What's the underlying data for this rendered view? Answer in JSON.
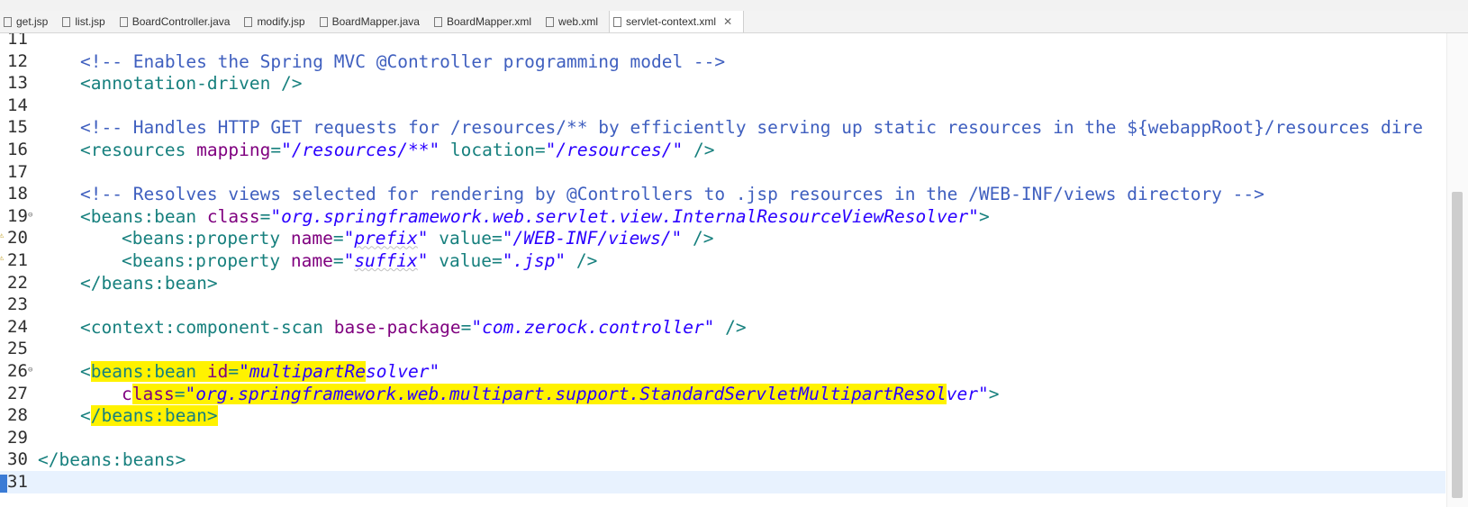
{
  "tabs": [
    {
      "label": "get.jsp",
      "icon": "jsp-file-icon"
    },
    {
      "label": "list.jsp",
      "icon": "jsp-file-icon"
    },
    {
      "label": "BoardController.java",
      "icon": "java-file-icon"
    },
    {
      "label": "modify.jsp",
      "icon": "jsp-file-icon"
    },
    {
      "label": "BoardMapper.java",
      "icon": "java-file-icon"
    },
    {
      "label": "BoardMapper.xml",
      "icon": "xml-file-icon"
    },
    {
      "label": "web.xml",
      "icon": "xml-file-icon"
    },
    {
      "label": "servlet-context.xml",
      "icon": "xml-file-icon",
      "active": true,
      "close": "✕"
    }
  ],
  "editor": {
    "lines": [
      {
        "n": "11",
        "t": []
      },
      {
        "n": "12",
        "t": [
          [
            "cm",
            "<!-- Enables the Spring MVC @Controller programming model -->"
          ]
        ]
      },
      {
        "n": "13",
        "t": [
          [
            "tg",
            "<annotation-driven />"
          ]
        ]
      },
      {
        "n": "14",
        "t": []
      },
      {
        "n": "15",
        "t": [
          [
            "cm",
            "<!-- Handles HTTP GET requests for /resources/** by efficiently serving up static resources in the ${webappRoot}/resources dire"
          ]
        ]
      },
      {
        "n": "16",
        "t": [
          [
            "tg",
            "<resources "
          ],
          [
            "at",
            "mapping"
          ],
          [
            "tg",
            "="
          ],
          [
            "st",
            "\"/resources/**\""
          ],
          [
            "tg",
            " location"
          ],
          [
            "tg",
            "="
          ],
          [
            "st",
            "\"/resources/\""
          ],
          [
            "tg",
            " />"
          ]
        ]
      },
      {
        "n": "17",
        "t": []
      },
      {
        "n": "18",
        "t": [
          [
            "cm",
            "<!-- Resolves views selected for rendering by @Controllers to .jsp resources in the /WEB-INF/views directory -->"
          ]
        ]
      },
      {
        "n": "19",
        "t": [
          [
            "tg",
            "<beans:bean "
          ],
          [
            "at",
            "class"
          ],
          [
            "tg",
            "="
          ],
          [
            "st",
            "\"org.springframework.web.servlet.view.InternalResourceViewResolver\""
          ],
          [
            "tg",
            ">"
          ]
        ]
      },
      {
        "n": "20",
        "t": [
          [
            "tg",
            "<beans:property "
          ],
          [
            "at",
            "name"
          ],
          [
            "tg",
            "="
          ],
          [
            "st",
            "\"prefix\""
          ],
          [
            "tg",
            " value"
          ],
          [
            "tg",
            "="
          ],
          [
            "st",
            "\"/WEB-INF/views/\""
          ],
          [
            "tg",
            " />"
          ]
        ]
      },
      {
        "n": "21",
        "t": [
          [
            "tg",
            "<beans:property "
          ],
          [
            "at",
            "name"
          ],
          [
            "tg",
            "="
          ],
          [
            "st",
            "\"suffix\""
          ],
          [
            "tg",
            " value"
          ],
          [
            "tg",
            "="
          ],
          [
            "st",
            "\".jsp\""
          ],
          [
            "tg",
            " />"
          ]
        ]
      },
      {
        "n": "22",
        "t": [
          [
            "tg",
            "</beans:bean>"
          ]
        ]
      },
      {
        "n": "23",
        "t": []
      },
      {
        "n": "24",
        "t": [
          [
            "tg",
            "<context:component-scan "
          ],
          [
            "at",
            "base-package"
          ],
          [
            "tg",
            "="
          ],
          [
            "st",
            "\"com.zerock.controller\""
          ],
          [
            "tg",
            " />"
          ]
        ]
      },
      {
        "n": "25",
        "t": []
      },
      {
        "n": "26",
        "t": [
          [
            "tg",
            "<"
          ],
          [
            "tgh",
            "beans:bean "
          ],
          [
            "ath",
            "id"
          ],
          [
            "tgh",
            "="
          ],
          [
            "sth",
            "\"multipartRe"
          ],
          [
            "st",
            "solver\""
          ]
        ]
      },
      {
        "n": "27",
        "t": [
          [
            "at",
            "c"
          ],
          [
            "ath",
            "lass"
          ],
          [
            "tgh",
            "="
          ],
          [
            "sth",
            "\"org.springframework.web.multipart.support.StandardServletMultipartResol"
          ],
          [
            "st",
            "ver\""
          ],
          [
            "tg",
            ">"
          ]
        ]
      },
      {
        "n": "28",
        "t": [
          [
            "tg",
            "<"
          ],
          [
            "tgh",
            "/beans:bean>"
          ]
        ]
      },
      {
        "n": "29",
        "t": []
      },
      {
        "n": "30",
        "t": [
          [
            "tg",
            "</beans:beans>"
          ]
        ]
      },
      {
        "n": "31",
        "t": []
      }
    ]
  }
}
